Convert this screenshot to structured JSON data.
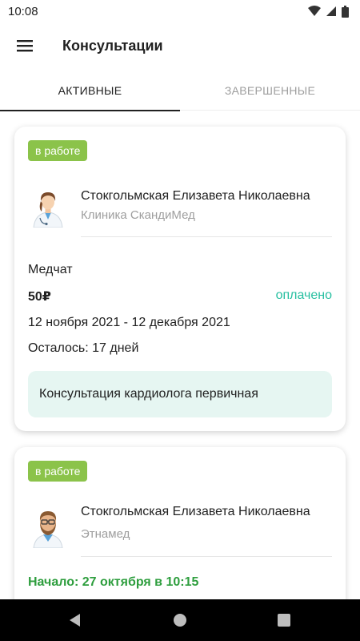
{
  "status_bar": {
    "time": "10:08",
    "icons": [
      "wifi-icon",
      "signal-icon",
      "battery-icon"
    ]
  },
  "app_bar": {
    "title": "Консультации",
    "menu_icon": "hamburger-menu-icon"
  },
  "tabs": [
    {
      "label": "АКТИВНЫЕ",
      "active": true
    },
    {
      "label": "ЗАВЕРШЕННЫЕ",
      "active": false
    }
  ],
  "consultations": [
    {
      "badge": "в работе",
      "doctor_name": "Стокгольмская Елизавета Николаевна",
      "clinic": "Клиника СкандиМед",
      "service_type": "Медчат",
      "price": "50₽",
      "payment_status": "оплачено",
      "period": "12 ноября 2021 - 12 декабря 2021",
      "remaining": "Осталось: 17 дней",
      "description": "Консультация кардиолога первичная"
    },
    {
      "badge": "в работе",
      "doctor_name": "Стокгольмская Елизавета Николаевна",
      "clinic": "Этнамед",
      "start": "Начало: 27 октября в 10:15"
    }
  ],
  "colors": {
    "badge": "#8bc34a",
    "paid": "#26bfa0",
    "start": "#2e9e3e",
    "description_bg": "#e6f6f2"
  },
  "nav_bar": {
    "icons": [
      "back-icon",
      "home-icon",
      "recents-icon"
    ]
  }
}
